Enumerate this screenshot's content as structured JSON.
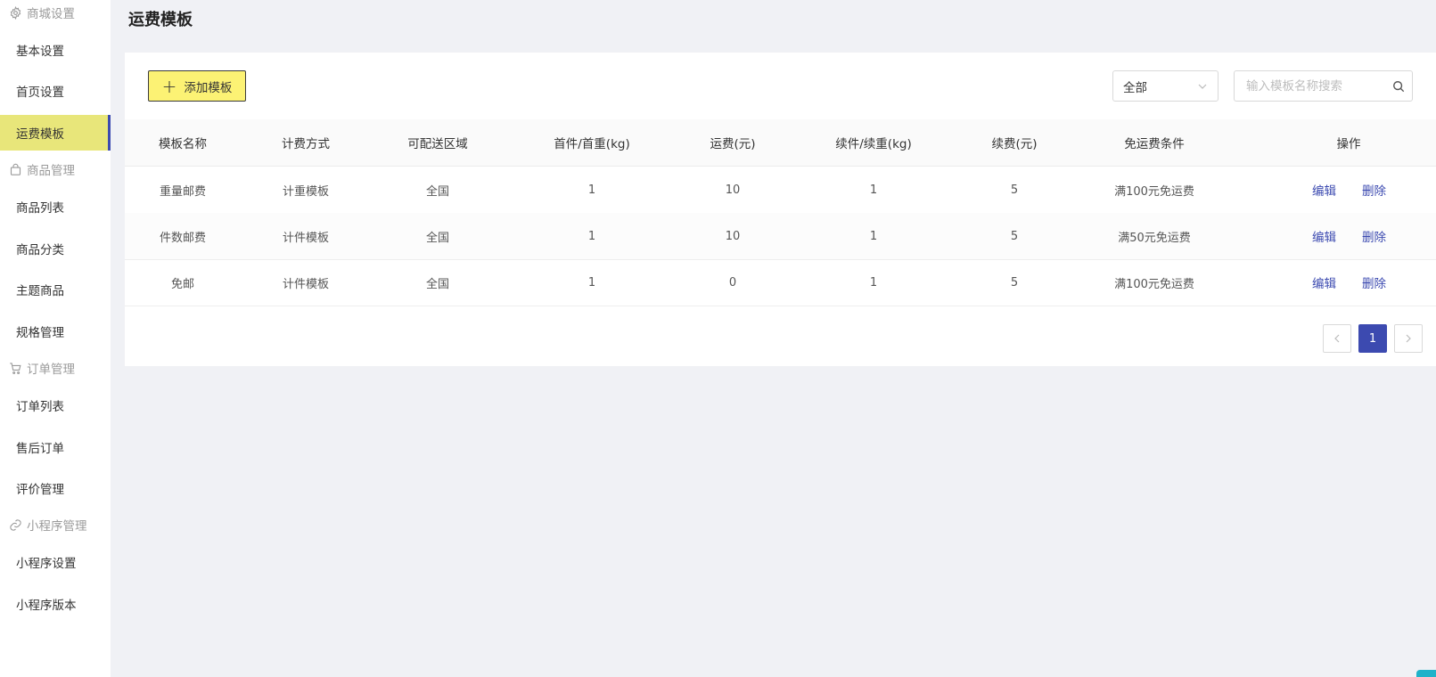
{
  "sidebar": {
    "groups": [
      {
        "title": "商城设置",
        "icon": "gear-icon",
        "items": [
          "基本设置",
          "首页设置",
          "运费模板"
        ]
      },
      {
        "title": "商品管理",
        "icon": "bag-icon",
        "items": [
          "商品列表",
          "商品分类",
          "主题商品",
          "规格管理"
        ]
      },
      {
        "title": "订单管理",
        "icon": "cart-icon",
        "items": [
          "订单列表",
          "售后订单",
          "评价管理"
        ]
      },
      {
        "title": "小程序管理",
        "icon": "link-icon",
        "items": [
          "小程序设置",
          "小程序版本"
        ]
      }
    ],
    "active_item": "运费模板"
  },
  "page": {
    "title": "运费模板"
  },
  "toolbar": {
    "add_label": "添加模板",
    "filter_value": "全部",
    "search_placeholder": "输入模板名称搜索"
  },
  "table": {
    "headers": [
      "模板名称",
      "计费方式",
      "可配送区域",
      "首件/首重(kg)",
      "运费(元)",
      "续件/续重(kg)",
      "续费(元)",
      "免运费条件",
      "操作"
    ],
    "rows": [
      [
        "重量邮费",
        "计重模板",
        "全国",
        "1",
        "10",
        "1",
        "5",
        "满100元免运费"
      ],
      [
        "件数邮费",
        "计件模板",
        "全国",
        "1",
        "10",
        "1",
        "5",
        "满50元免运费"
      ],
      [
        "免邮",
        "计件模板",
        "全国",
        "1",
        "0",
        "1",
        "5",
        "满100元免运费"
      ]
    ],
    "actions": {
      "edit": "编辑",
      "delete": "删除"
    }
  },
  "pagination": {
    "current_page": "1"
  },
  "colors": {
    "accent": "#3c4ab0",
    "active_bg": "#e8e67a",
    "button_bg": "#fcf274",
    "corner": "#1fb2c9"
  }
}
